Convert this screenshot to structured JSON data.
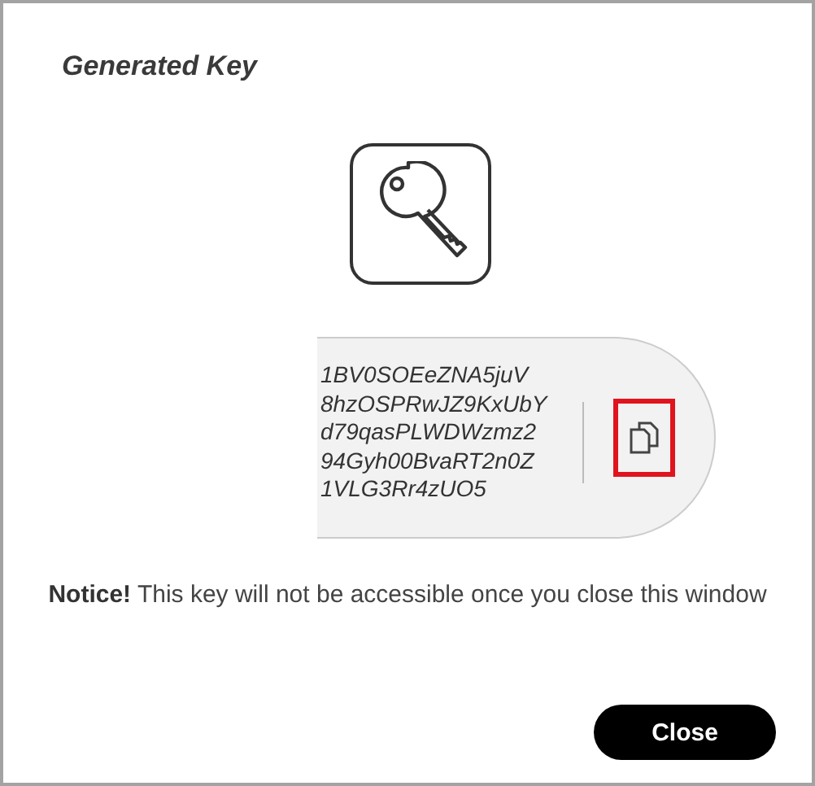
{
  "dialog": {
    "title": "Generated Key"
  },
  "key_field": {
    "lines": [
      "1BV0SOEeZNA5juV",
      "8hzOSPRwJZ9KxUbY",
      "d79qasPLWDWzmz2",
      "94Gyh00BvaRT2n0Z",
      "1VLG3Rr4zUO5"
    ],
    "copy_highlighted": true
  },
  "notice": "**Notice!** This key will not be accessible once you close this window",
  "buttons": [
    "Close"
  ]
}
